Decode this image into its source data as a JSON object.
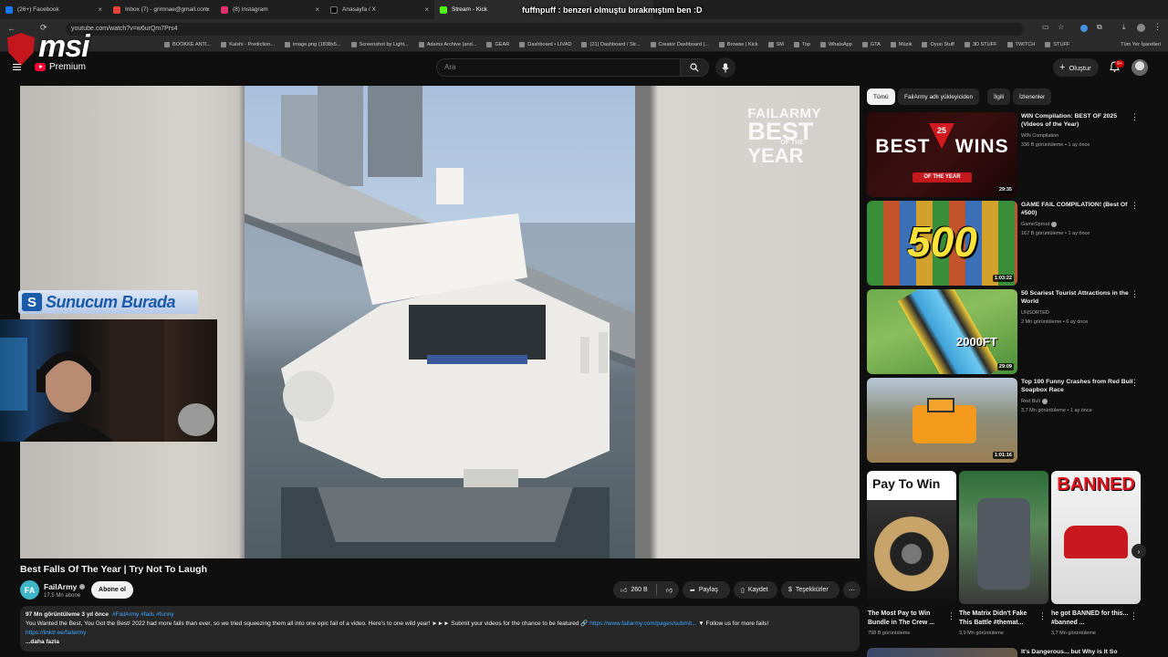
{
  "browser": {
    "tabs": [
      {
        "label": "(26+) Facebook",
        "color": "#1877f2"
      },
      {
        "label": "Inbox (7) - grimnae@gmail.com",
        "color": "#ea4335"
      },
      {
        "label": "(8) Instagram",
        "color": "#e1306c"
      },
      {
        "label": "Anasayfa / X",
        "color": "#000000"
      },
      {
        "label": "Stream - Kick",
        "color": "#53fc18"
      }
    ],
    "overlay_text": "fuffnpuff : benzeri olmuştu bırakmıştım ben :D",
    "url": "youtube.com/watch?v=w6urQm7Prs4",
    "bookmarks": [
      "BOOKKE ANTI...",
      "Kalshi - Prediction...",
      "image.png (1838x5...",
      "Screenshot by Light...",
      "Adams Archive (and...",
      "GEAR",
      "Dashboard • LIVAD",
      "(21) Dashboard / Str...",
      "Creator Dashboard |...",
      "Browse | Kick",
      "SM",
      "Top",
      "WhatsApp",
      "GTA",
      "Müzik",
      "Oyun Stuff",
      "3D STUFF",
      "TWITCH",
      "STUFF"
    ],
    "all_bookmarks": "Tüm Yer İşaretleri"
  },
  "overlay": {
    "msi": "msi",
    "sunucum": "Sunucum Burada",
    "sunucum_logo": "S"
  },
  "header": {
    "premium": "Premium",
    "search_placeholder": "Ara",
    "create": "Oluştur",
    "notif_count": "9+"
  },
  "player": {
    "watermark_l1": "FAILARMY",
    "watermark_l2": "BEST",
    "watermark_of_the": "OF THE",
    "watermark_l3": "YEAR"
  },
  "video": {
    "title": "Best Falls Of The Year | Try Not To Laugh",
    "channel": "FailArmy",
    "channel_initial": "FA",
    "subs": "17,5 Mn abone",
    "subscribe": "Abone ol",
    "likes": "260 B",
    "share": "Paylaş",
    "save": "Kaydet",
    "thanks": "Teşekkürler",
    "views_date": "97 Mn görüntüleme  3 yıl önce",
    "tags": "#FailArmy #fails #funny",
    "description": "You Wanted the Best, You Got the Best! 2022 had more fails than ever, so we tried squeezing them all into one epic fail of a video. Here's to one wild year! ►►► Submit your videos for the chance to be featured 🔗",
    "desc_link": "https://www.failarmy.com/pages/submit...",
    "desc_tail": " ▼ Follow us for more fails!",
    "desc_link2": "https://linktr.ee/failarmy",
    "more": "...daha fazla"
  },
  "chips": [
    "Tümü",
    "FailArmy adlı yükleyiciden",
    "İlgili",
    "İzlenenler"
  ],
  "recommendations": [
    {
      "title": "WIN Compilation: BEST OF 2025 (Videos of the Year)",
      "channel": "WIN Compilation",
      "verified": false,
      "meta": "336 B görüntüleme • 1 ay önce",
      "duration": "29:35",
      "thumb_text": "BEST 25 WINS",
      "thumb_sub": "OF THE YEAR",
      "thumb_big": "BEST",
      "thumb_big2": "WINS",
      "thumb_num": "25"
    },
    {
      "title": "GAME FAIL COMPILATION! (Best Of #500)",
      "channel": "GameSprout",
      "verified": true,
      "meta": "167 B görüntüleme • 1 ay önce",
      "duration": "1:03:22",
      "thumb_num": "500"
    },
    {
      "title": "50 Scariest Tourist Attractions in the World",
      "channel": "UNSORTED",
      "verified": false,
      "meta": "2 Mn görüntüleme • 6 ay önce",
      "duration": "29:09",
      "thumb_num": "2000FT"
    },
    {
      "title": "Top 100 Funny Crashes from Red Bull Soapbox Race",
      "channel": "Red Bull",
      "verified": true,
      "meta": "3,7 Mn görüntüleme • 1 ay önce",
      "duration": "1:01:16"
    }
  ],
  "shorts": [
    {
      "title": "The Most Pay to Win Bundle in The Crew ...",
      "meta": "798 B görüntüleme",
      "thumb_text": "Pay To Win"
    },
    {
      "title": "The Matrix Didn't Fake This Battle #themat...",
      "meta": "3,9 Mn görüntüleme"
    },
    {
      "title": "he got BANNED for this... #banned ...",
      "meta": "3,7 Mn görüntüleme",
      "thumb_text": "BANNED"
    }
  ],
  "last_rec_title": "It's Dangerous... but Why is It So"
}
